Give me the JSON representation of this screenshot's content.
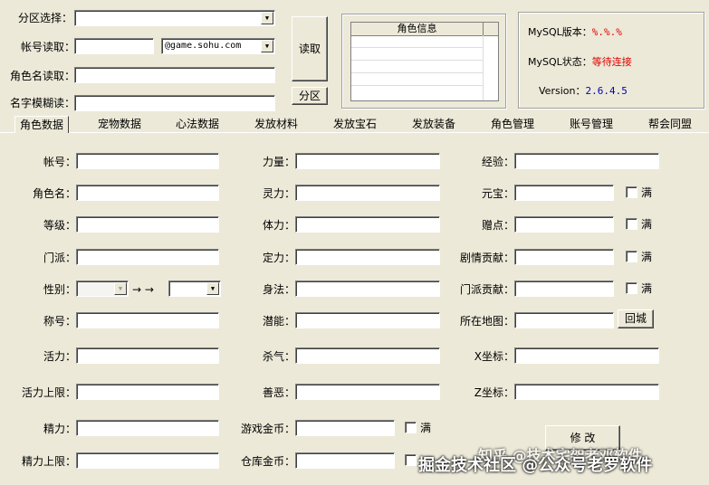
{
  "top": {
    "zone_label": "分区选择：",
    "account_read_label": "帐号读取：",
    "account_domain": "@game.sohu.com",
    "role_read_label": "角色名读取：",
    "fuzzy_read_label": "名字模糊读：",
    "read_button": "读取",
    "zone_button": "分区",
    "role_info_header": "角色信息"
  },
  "mysql": {
    "version_label": "MySQL版本：",
    "version_value": "%.%.%",
    "status_label": "MySQL状态：",
    "status_value": "等待连接",
    "app_version_label": "Version：",
    "app_version_value": "2.6.4.5"
  },
  "tabs": [
    "角色数据",
    "宠物数据",
    "心法数据",
    "发放材料",
    "发放宝石",
    "发放装备",
    "角色管理",
    "账号管理",
    "帮会同盟"
  ],
  "form": {
    "col1": [
      "帐号：",
      "角色名：",
      "等级：",
      "门派：",
      "性别：",
      "称号：",
      "活力：",
      "活力上限：",
      "精力：",
      "精力上限："
    ],
    "col2": [
      "力量：",
      "灵力：",
      "体力：",
      "定力：",
      "身法：",
      "潜能：",
      "杀气：",
      "善恶：",
      "游戏金币：",
      "仓库金币："
    ],
    "col3": [
      "经验：",
      "元宝：",
      "赠点：",
      "剧情贡献：",
      "门派贡献：",
      "所在地图：",
      "X坐标：",
      "Z坐标："
    ],
    "arrows": "→ →",
    "full_label": "满",
    "return_city_button": "回城",
    "modify_button": "修 改"
  },
  "watermark": {
    "line1": "知乎 @技术宅架老邓软件",
    "line2": "掘金技术社区 @公众号老罗软件"
  }
}
